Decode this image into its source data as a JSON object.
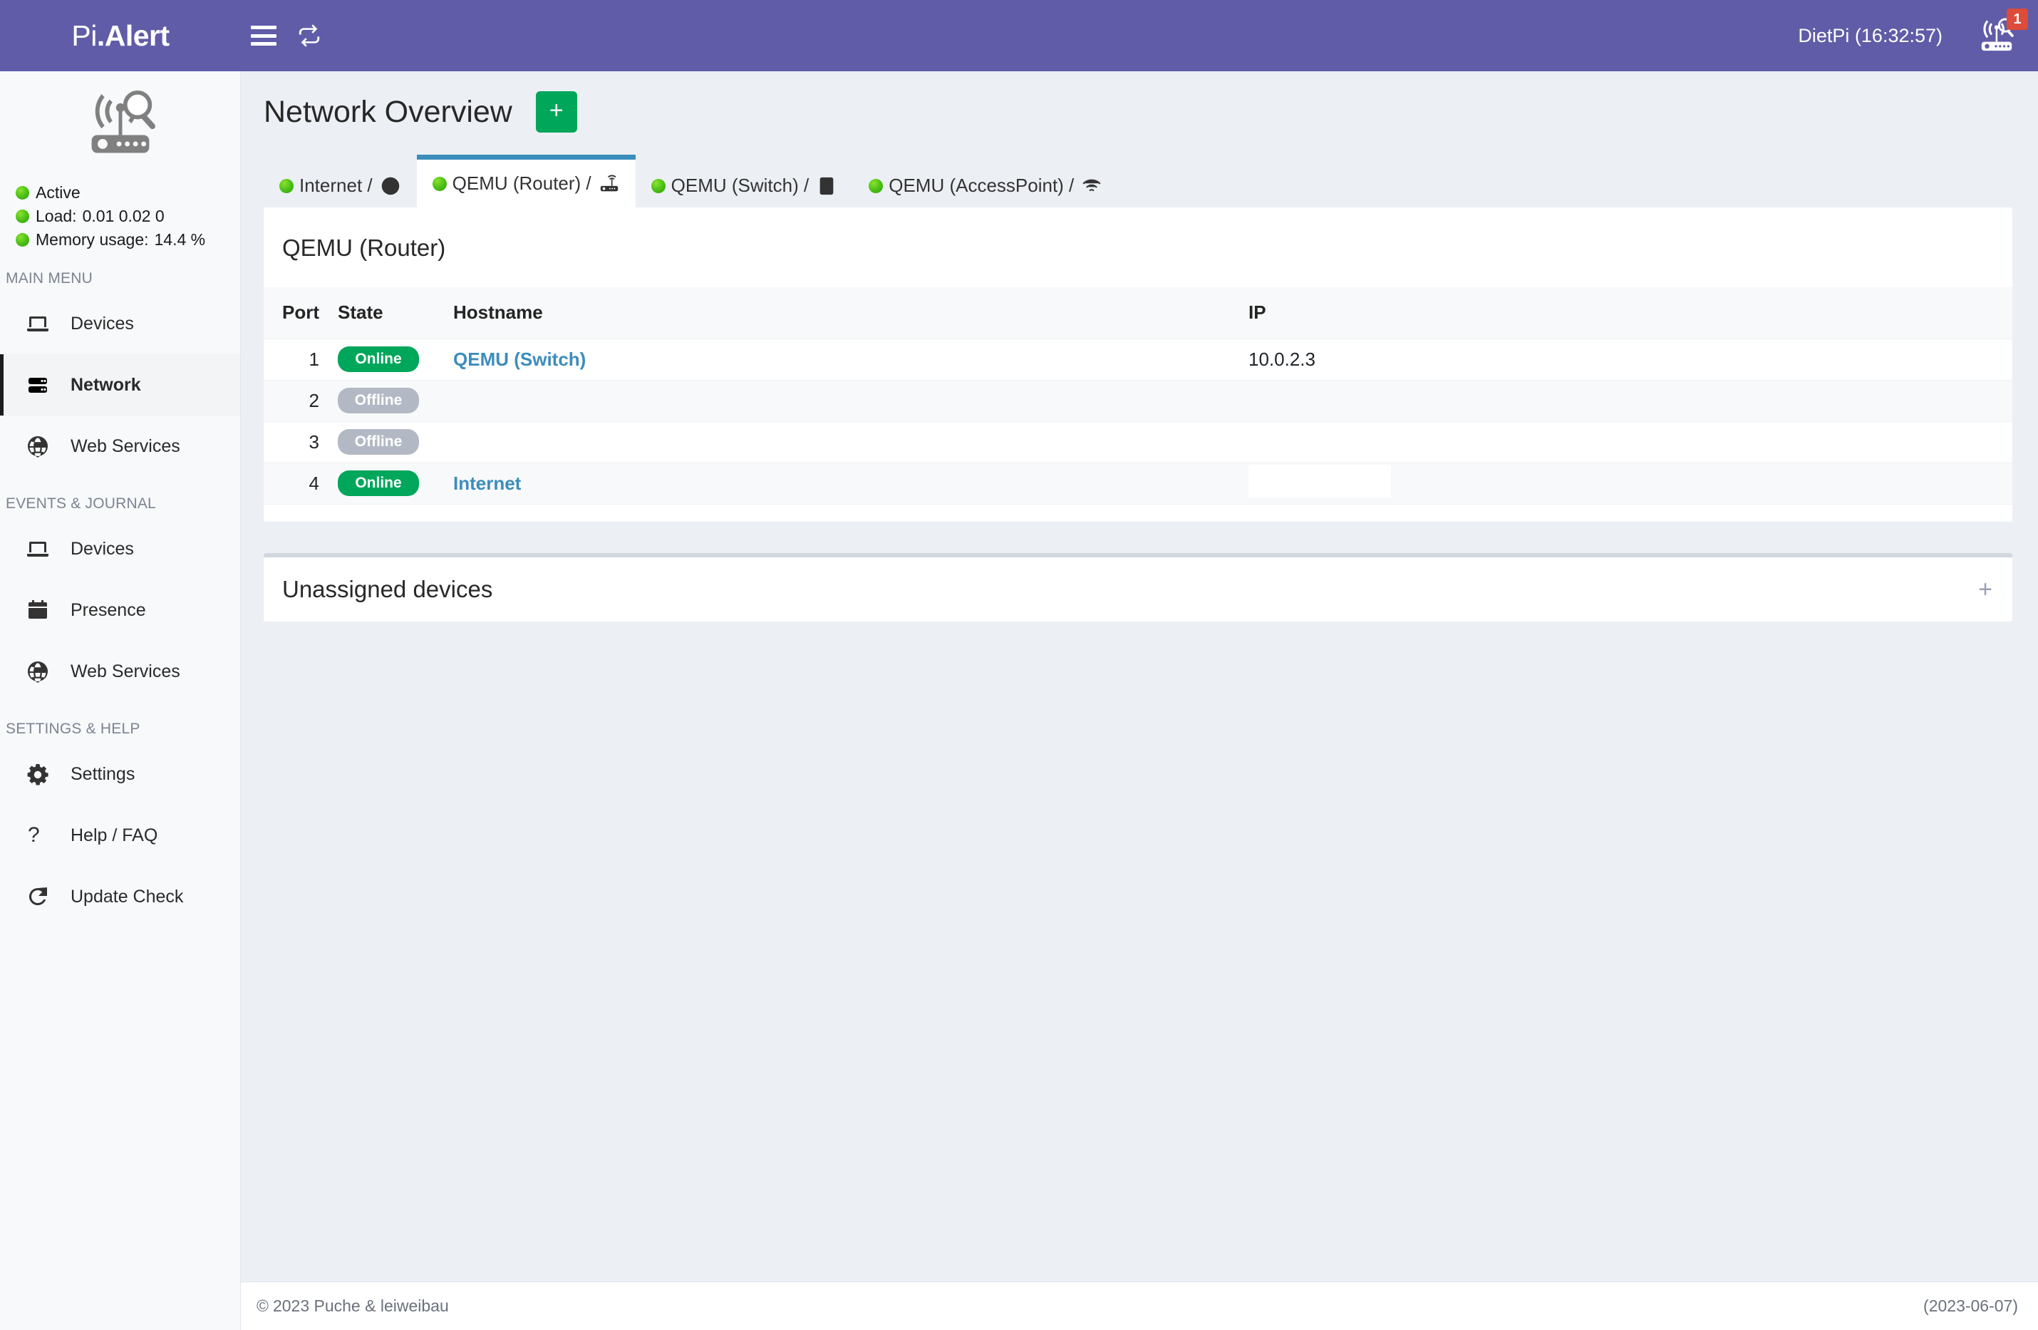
{
  "header": {
    "logo_light": "Pi",
    "logo_bold": ".Alert",
    "menu_toggle_icon": "hamburger-icon",
    "refresh_icon": "refresh-icon",
    "user_label": "DietPi (16:32:57)",
    "notification_icon": "pialert-router-icon",
    "notification_count": "1",
    "bg_color": "#605ca8",
    "badge_color": "#dd4b39"
  },
  "sidebar": {
    "brand_icon": "pialert-router-radar-icon",
    "status": [
      {
        "icon": "green-dot",
        "label": "Active",
        "value": ""
      },
      {
        "icon": "green-dot",
        "label": "Load:",
        "value": "0.01  0.02  0"
      },
      {
        "icon": "green-dot",
        "label": "Memory usage:",
        "value": "14.4 %"
      }
    ],
    "sections": [
      {
        "header": "MAIN MENU",
        "items": [
          {
            "label": "Devices",
            "icon": "laptop-icon",
            "active": false
          },
          {
            "label": "Network",
            "icon": "server-icon",
            "active": true
          },
          {
            "label": "Web Services",
            "icon": "globe-icon",
            "active": false
          }
        ]
      },
      {
        "header": "EVENTS & JOURNAL",
        "items": [
          {
            "label": "Devices",
            "icon": "laptop-icon",
            "active": false
          },
          {
            "label": "Presence",
            "icon": "calendar-icon",
            "active": false
          },
          {
            "label": "Web Services",
            "icon": "globe-icon",
            "active": false
          }
        ]
      },
      {
        "header": "SETTINGS & HELP",
        "items": [
          {
            "label": "Settings",
            "icon": "gear-icon",
            "active": false
          },
          {
            "label": "Help / FAQ",
            "icon": "question-icon",
            "active": false
          },
          {
            "label": "Update Check",
            "icon": "refresh-arrow-icon",
            "active": false
          }
        ]
      }
    ]
  },
  "main": {
    "page_title": "Network Overview",
    "add_button_label": "+",
    "accent_green": "#00a65a",
    "accent_blue": "#3c8dbc",
    "tabs": [
      {
        "status": "online",
        "label": "Internet /",
        "icon": "globe-icon",
        "active": false
      },
      {
        "status": "online",
        "label": "QEMU (Router) /",
        "icon": "router-icon",
        "active": true
      },
      {
        "status": "online",
        "label": "QEMU (Switch) /",
        "icon": "switch-icon",
        "active": false
      },
      {
        "status": "online",
        "label": "QEMU (AccessPoint) /",
        "icon": "wifi-icon",
        "active": false
      }
    ],
    "panel": {
      "title": "QEMU (Router)",
      "columns": [
        "Port",
        "State",
        "Hostname",
        "IP"
      ],
      "rows": [
        {
          "port": "1",
          "state": "Online",
          "state_kind": "online",
          "hostname": "QEMU (Switch)",
          "hostname_link": true,
          "ip": "10.0.2.3",
          "ip_blank_box": false
        },
        {
          "port": "2",
          "state": "Offline",
          "state_kind": "offline",
          "hostname": "",
          "hostname_link": false,
          "ip": "",
          "ip_blank_box": false
        },
        {
          "port": "3",
          "state": "Offline",
          "state_kind": "offline",
          "hostname": "",
          "hostname_link": false,
          "ip": "",
          "ip_blank_box": false
        },
        {
          "port": "4",
          "state": "Online",
          "state_kind": "online",
          "hostname": "Internet",
          "hostname_link": true,
          "ip": "",
          "ip_blank_box": true
        }
      ]
    },
    "unassigned": {
      "title": "Unassigned devices",
      "collapse_icon": "plus-icon",
      "collapse_label": "+"
    }
  },
  "footer": {
    "copyright_mark": "©",
    "copyright": "2023 Puche & leiweibau",
    "version_date": "(2023-06-07)"
  }
}
